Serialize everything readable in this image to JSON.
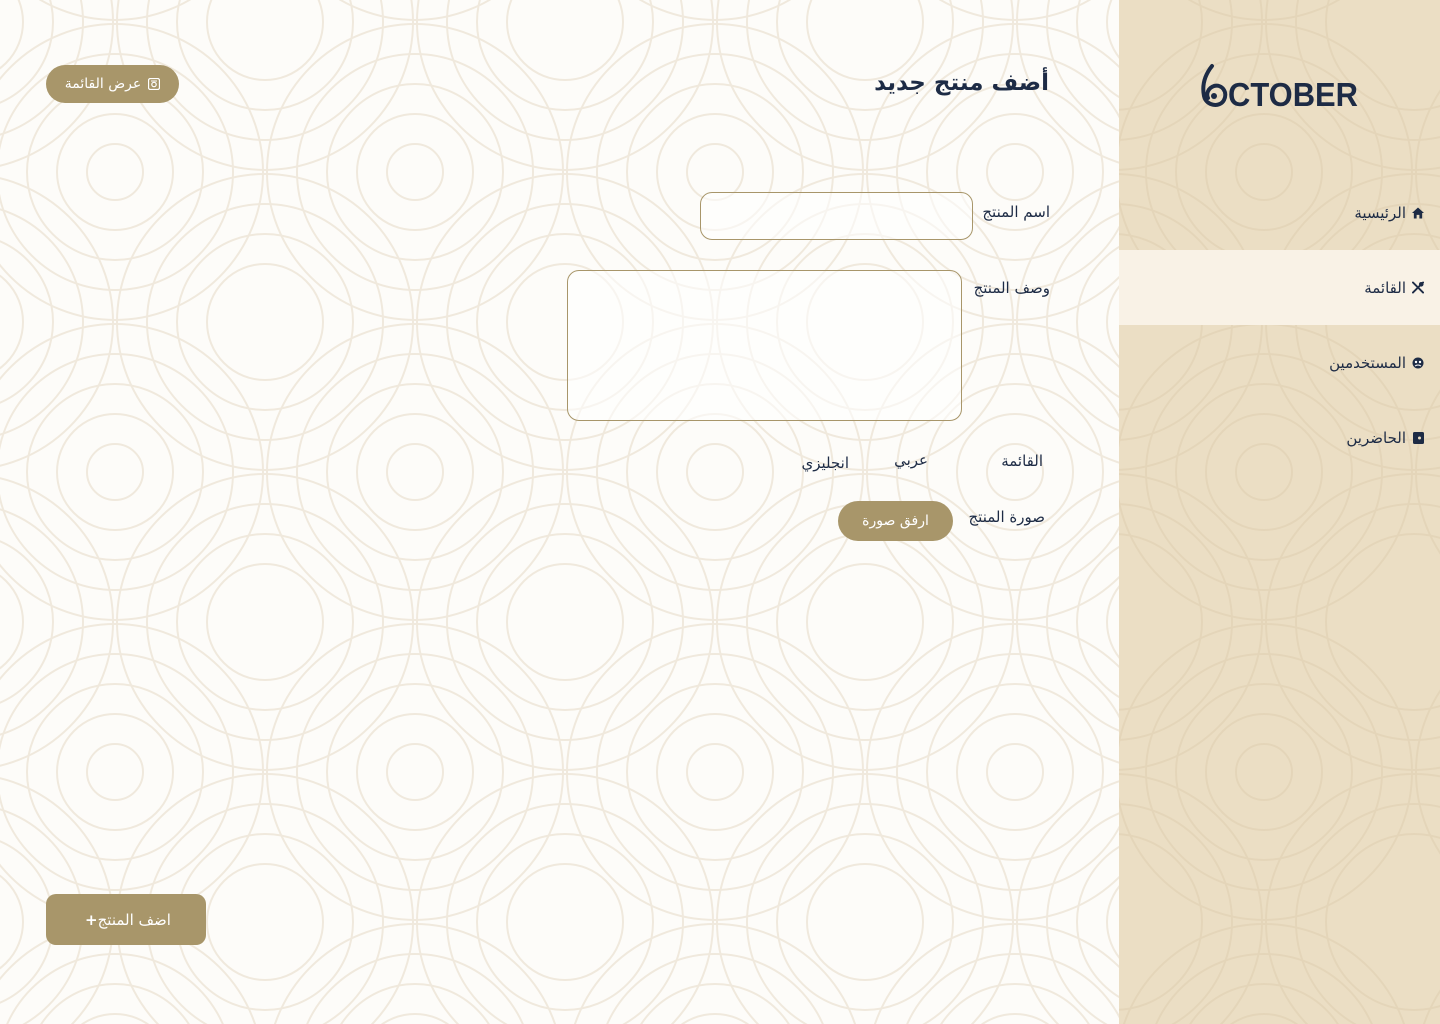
{
  "brand": {
    "logo_text": "CTOBER",
    "logo_numeral": "6"
  },
  "sidebar": {
    "items": [
      {
        "label": "الرئيسية",
        "icon": "home-icon",
        "active": false
      },
      {
        "label": "القائمة",
        "icon": "utensils-icon",
        "active": true
      },
      {
        "label": "المستخدمين",
        "icon": "users-icon",
        "active": false
      },
      {
        "label": "الحاضرين",
        "icon": "attendance-icon",
        "active": false
      }
    ]
  },
  "header": {
    "title": "أضف منتج جديد",
    "view_menu_label": "عرض القائمة"
  },
  "form": {
    "name_label": "اسم المنتج",
    "name_value": "",
    "description_label": "وصف المنتج",
    "description_value": "",
    "menu_label": "القائمة",
    "arabic_label": "عربي",
    "english_label": "انجليزي",
    "image_label": "صورة المنتج",
    "attach_label": "ارفق صورة",
    "submit_label": "اضف المنتج",
    "submit_icon": "+"
  },
  "colors": {
    "accent": "#a8966a",
    "sidebar_bg": "#ebdec4",
    "sidebar_active": "#f9f2e6",
    "text_dark": "#1d2b45",
    "main_bg": "#fdfcf9"
  }
}
